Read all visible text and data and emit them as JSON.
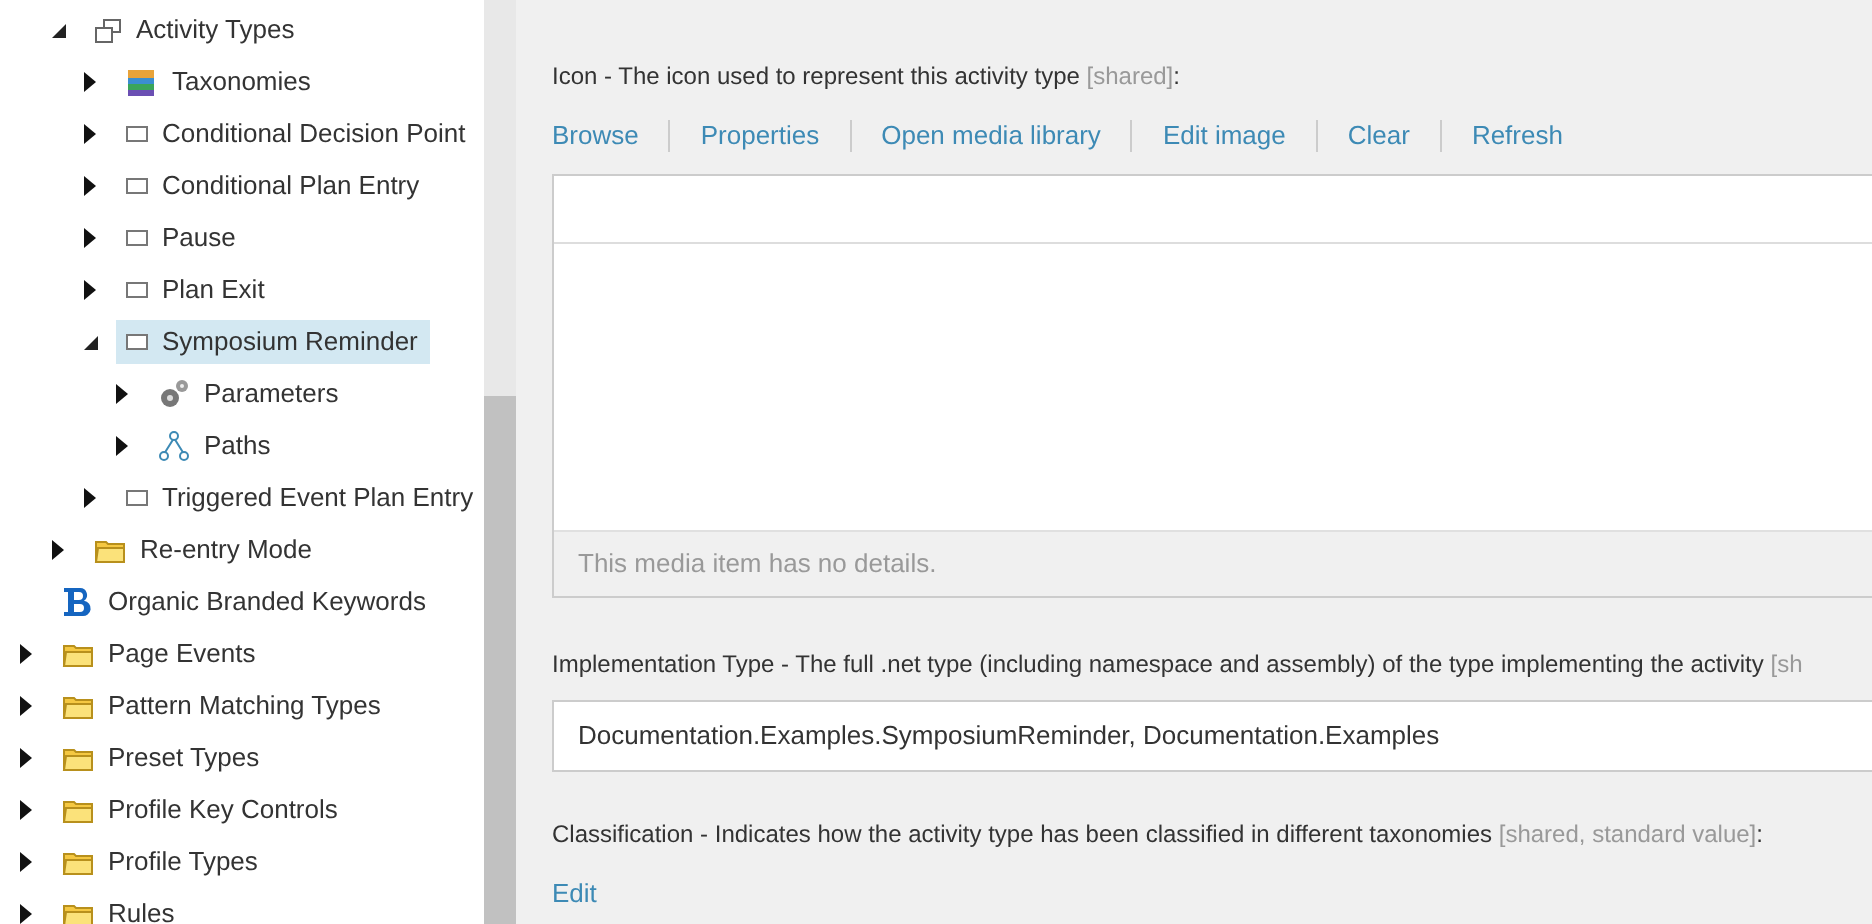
{
  "tree": {
    "nested_items": [
      {
        "label": "Activity Types",
        "kind": "windows",
        "expanded": true,
        "selected": false,
        "children": [
          {
            "label": "Taxonomies",
            "kind": "stack",
            "expanded": false,
            "selected": false
          },
          {
            "label": "Conditional Decision Point",
            "kind": "item",
            "expanded": false,
            "selected": false
          },
          {
            "label": "Conditional Plan Entry",
            "kind": "item",
            "expanded": false,
            "selected": false
          },
          {
            "label": "Pause",
            "kind": "item",
            "expanded": false,
            "selected": false
          },
          {
            "label": "Plan Exit",
            "kind": "item",
            "expanded": false,
            "selected": false
          },
          {
            "label": "Symposium Reminder",
            "kind": "item",
            "expanded": true,
            "selected": true,
            "children": [
              {
                "label": "Parameters",
                "kind": "gears",
                "expanded": false,
                "selected": false
              },
              {
                "label": "Paths",
                "kind": "paths",
                "expanded": false,
                "selected": false
              }
            ]
          },
          {
            "label": "Triggered Event Plan Entry",
            "kind": "item",
            "expanded": false,
            "selected": false
          }
        ]
      },
      {
        "label": "Re-entry Mode",
        "kind": "folder",
        "expanded": false,
        "selected": false
      }
    ],
    "items": [
      {
        "label": "Organic Branded Keywords",
        "kind": "brand",
        "selected": false
      },
      {
        "label": "Page Events",
        "kind": "folder",
        "expanded": false,
        "selected": false
      },
      {
        "label": "Pattern Matching Types",
        "kind": "folder",
        "expanded": false,
        "selected": false
      },
      {
        "label": "Preset Types",
        "kind": "folder",
        "expanded": false,
        "selected": false
      },
      {
        "label": "Profile Key Controls",
        "kind": "folder",
        "expanded": false,
        "selected": false
      },
      {
        "label": "Profile Types",
        "kind": "folder",
        "expanded": false,
        "selected": false
      },
      {
        "label": "Rules",
        "kind": "folder",
        "expanded": false,
        "selected": false
      }
    ]
  },
  "fields": [
    {
      "kind": "media",
      "label": "Icon - The icon used to represent this activity type",
      "note": "[shared]",
      "suffix": ":",
      "links": [
        "Browse",
        "Properties",
        "Open media library",
        "Edit image",
        "Clear",
        "Refresh"
      ],
      "details": "This media item has no details."
    },
    {
      "kind": "text",
      "label": "Implementation Type - The full .net type (including namespace and assembly) of the type implementing the activity",
      "note": "[sh",
      "value": "Documentation.Examples.SymposiumReminder, Documentation.Examples"
    },
    {
      "kind": "taxonomy",
      "label": "Classification - Indicates how the activity type has been classified in different taxonomies",
      "note": "[shared, standard value]",
      "suffix": ":",
      "links": [
        "Edit"
      ]
    }
  ]
}
